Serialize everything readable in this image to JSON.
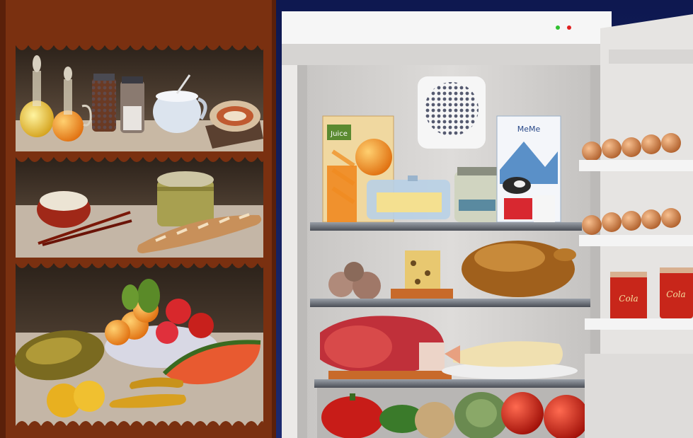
{
  "scene": {
    "pantry": {
      "shelf_1": [
        "olive-oil-cruet",
        "vinegar-cruet",
        "pepper-jar",
        "salt-jar",
        "sugar-bowl",
        "tinned-fish"
      ],
      "shelf_2": [
        "rice-bowl",
        "chopsticks",
        "grain-canister",
        "baguette"
      ],
      "shelf_3": [
        "fruit-bowl",
        "papaya",
        "watermelon-slice",
        "lemons",
        "bananas"
      ]
    },
    "fridge": {
      "top_shelf": [
        "juice-carton",
        "juice-glass",
        "butter-dish",
        "jar",
        "milk-carton",
        "milk-glass"
      ],
      "middle_shelf": [
        "onions",
        "cheese-wedge",
        "roast-chicken"
      ],
      "lower_shelf": [
        "ham",
        "fish-on-plate"
      ],
      "crisper": [
        "red-pepper",
        "cucumber",
        "potato",
        "cabbage",
        "tomatoes"
      ],
      "door": [
        "eggs",
        "soda-cans"
      ]
    },
    "colors": {
      "pantry_wood": "#7a3010",
      "pantry_shelf_bg": "#3a2a1e",
      "fridge_interior": "#d4d2d0",
      "fridge_shelf": "#55585e",
      "night_sky": "#14205a"
    }
  },
  "labels": {
    "carton_top": "Juice",
    "milk_brand": "MeMe",
    "can_text": "Cola"
  }
}
